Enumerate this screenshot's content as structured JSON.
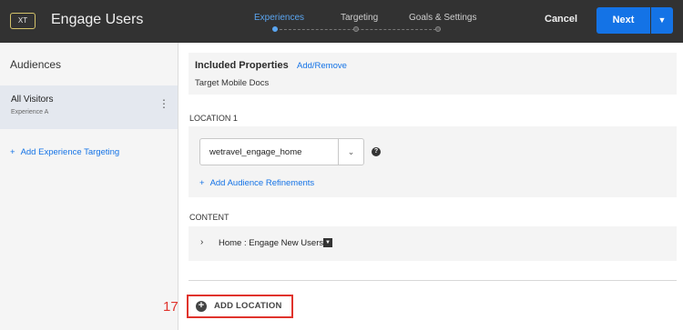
{
  "header": {
    "badge": "XT",
    "title": "Engage Users",
    "steps": [
      {
        "label": "Experiences",
        "active": true
      },
      {
        "label": "Targeting",
        "active": false
      },
      {
        "label": "Goals & Settings",
        "active": false
      }
    ],
    "cancel_label": "Cancel",
    "next_label": "Next",
    "dropdown_icon": "chevron-down-icon",
    "accent_color": "#1473e6"
  },
  "sidebar": {
    "title": "Audiences",
    "audiences": [
      {
        "name": "All Visitors",
        "experience": "Experience A"
      }
    ],
    "add_targeting_label": "Add Experience Targeting"
  },
  "main": {
    "properties": {
      "title": "Included Properties",
      "link": "Add/Remove",
      "value": "Target Mobile Docs"
    },
    "location": {
      "label": "LOCATION 1",
      "selected": "wetravel_engage_home",
      "help": "?",
      "add_refinements_label": "Add Audience Refinements"
    },
    "content": {
      "label": "CONTENT",
      "item": "Home : Engage New Users"
    },
    "add_location_label": "ADD LOCATION",
    "step_number": "17",
    "highlight_color": "#e0332c"
  }
}
